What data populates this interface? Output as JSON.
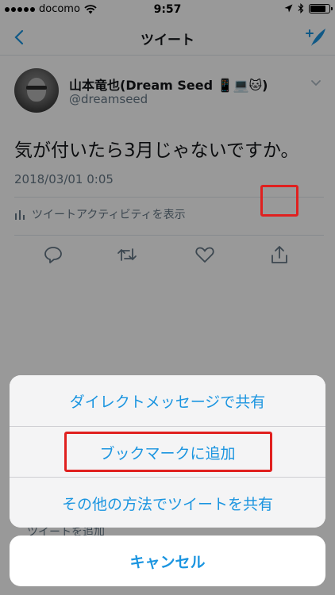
{
  "status_bar": {
    "carrier": "docomo",
    "time": "9:57",
    "battery_level": 0.9
  },
  "nav": {
    "title": "ツイート",
    "back_icon": "chevron-left-icon",
    "compose_icon": "compose-tweet-icon"
  },
  "tweet": {
    "author_name": "山本竜也(Dream Seed 📱💻🐱)",
    "author_handle": "@dreamseed",
    "text": "気が付いたら3月じゃないですか。",
    "timestamp": "2018/03/01 0:05",
    "activity_label": "ツイートアクティビティを表示"
  },
  "behind_text": "ツイートを追加",
  "action_sheet": {
    "items": [
      {
        "label": "ダイレクトメッセージで共有"
      },
      {
        "label": "ブックマークに追加"
      },
      {
        "label": "その他の方法でツイートを共有"
      }
    ],
    "cancel_label": "キャンセル"
  },
  "colors": {
    "accent": "#1b95e0",
    "highlight": "#e0201f",
    "secondary_text": "#657786"
  }
}
